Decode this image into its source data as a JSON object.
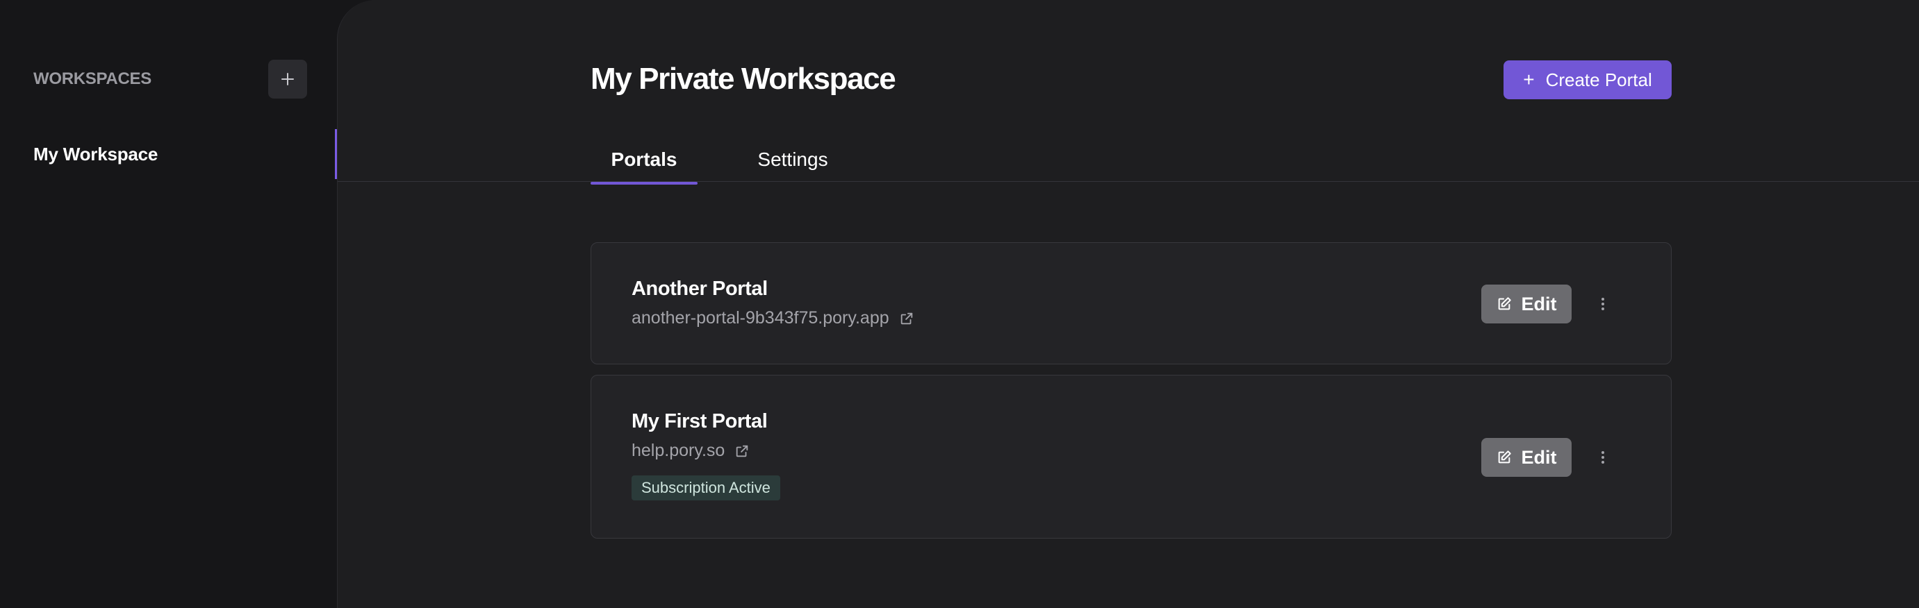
{
  "sidebar": {
    "title": "WORKSPACES",
    "add_icon": "plus-icon",
    "items": [
      {
        "label": "My Workspace",
        "active": true
      }
    ]
  },
  "main": {
    "title": "My Private Workspace",
    "create_button": {
      "icon": "plus",
      "label": "Create Portal"
    },
    "tabs": [
      {
        "label": "Portals",
        "active": true
      },
      {
        "label": "Settings",
        "active": false
      }
    ],
    "portals": [
      {
        "name": "Another Portal",
        "url": "another-portal-9b343f75.pory.app",
        "edit_label": "Edit",
        "badge": null
      },
      {
        "name": "My First Portal",
        "url": "help.pory.so",
        "edit_label": "Edit",
        "badge": "Subscription Active"
      }
    ]
  },
  "colors": {
    "accent": "#7257d6",
    "sidebar_bg": "#161618",
    "main_bg": "#1e1e20",
    "card_bg": "#232326",
    "badge_bg": "#2b3b3a",
    "edit_button_bg": "#6b6b6f"
  }
}
